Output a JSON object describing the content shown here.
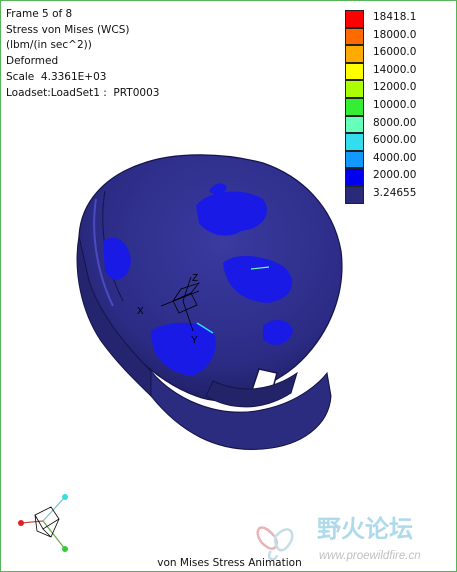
{
  "info": {
    "frame": "Frame 5 of 8",
    "result": "Stress von Mises (WCS)",
    "units": "(lbm/(in sec^2))",
    "mode": "Deformed",
    "scale": "Scale  4.3361E+03",
    "loadset": "Loadset:LoadSet1 :  PRT0003"
  },
  "legend": {
    "items": [
      {
        "label": "18418.1",
        "color": "#ff0000"
      },
      {
        "label": "18000.0",
        "color": "#ff6a00"
      },
      {
        "label": "16000.0",
        "color": "#ffaa00"
      },
      {
        "label": "14000.0",
        "color": "#ffff00"
      },
      {
        "label": "12000.0",
        "color": "#aaff00"
      },
      {
        "label": "10000.0",
        "color": "#33ee33"
      },
      {
        "label": "8000.00",
        "color": "#66ffbb"
      },
      {
        "label": "6000.00",
        "color": "#33ddee"
      },
      {
        "label": "4000.00",
        "color": "#1199ff"
      },
      {
        "label": "2000.00",
        "color": "#0000ee"
      },
      {
        "label": "3.24655",
        "color": "#2a2a7a"
      }
    ]
  },
  "axes_labels": {
    "x": "X",
    "y": "Y",
    "z": "Z"
  },
  "caption": "von Mises Stress Animation",
  "watermark": {
    "brand": "野火论坛",
    "url": "www.proewildfire.cn"
  },
  "colors": {
    "model_base": "#2c2c86",
    "model_high": "#1a1ae6",
    "model_dark": "#1a1a55",
    "frame_border": "#58b458"
  }
}
